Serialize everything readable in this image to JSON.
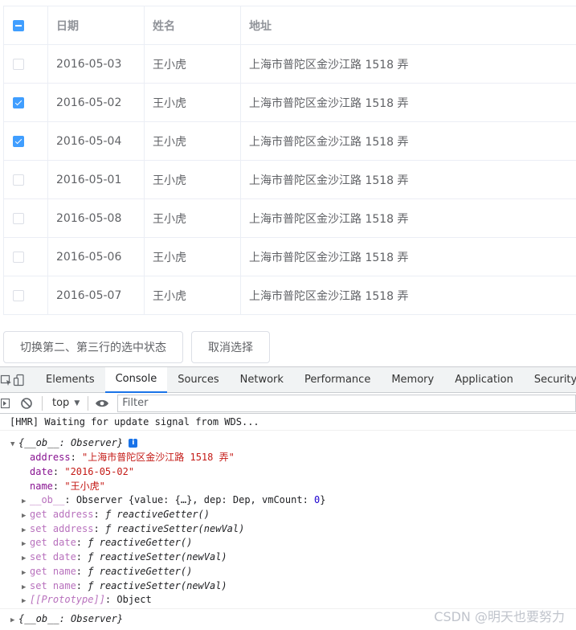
{
  "table": {
    "headers": {
      "date": "日期",
      "name": "姓名",
      "address": "地址"
    },
    "rows": [
      {
        "checked": false,
        "date": "2016-05-03",
        "name": "王小虎",
        "address": "上海市普陀区金沙江路 1518 弄"
      },
      {
        "checked": true,
        "date": "2016-05-02",
        "name": "王小虎",
        "address": "上海市普陀区金沙江路 1518 弄"
      },
      {
        "checked": true,
        "date": "2016-05-04",
        "name": "王小虎",
        "address": "上海市普陀区金沙江路 1518 弄"
      },
      {
        "checked": false,
        "date": "2016-05-01",
        "name": "王小虎",
        "address": "上海市普陀区金沙江路 1518 弄"
      },
      {
        "checked": false,
        "date": "2016-05-08",
        "name": "王小虎",
        "address": "上海市普陀区金沙江路 1518 弄"
      },
      {
        "checked": false,
        "date": "2016-05-06",
        "name": "王小虎",
        "address": "上海市普陀区金沙江路 1518 弄"
      },
      {
        "checked": false,
        "date": "2016-05-07",
        "name": "王小虎",
        "address": "上海市普陀区金沙江路 1518 弄"
      }
    ]
  },
  "buttons": {
    "toggle_label": "切换第二、第三行的选中状态",
    "clear_label": "取消选择"
  },
  "devtools": {
    "tabs": [
      "Elements",
      "Console",
      "Sources",
      "Network",
      "Performance",
      "Memory",
      "Application",
      "Security"
    ],
    "active_tab": "Console",
    "context": "top",
    "filter_placeholder": "Filter",
    "console": {
      "hmr": "[HMR] Waiting for update signal from WDS...",
      "obj_head_prefix": "{",
      "obj_head_key": "__ob__",
      "obj_head_sep": ": ",
      "obj_head_type": "Observer",
      "obj_head_suffix": "}",
      "info_badge": "i",
      "prop_address_key": "address",
      "prop_address_val": "\"上海市普陀区金沙江路 1518 弄\"",
      "prop_date_key": "date",
      "prop_date_val": "\"2016-05-02\"",
      "prop_name_key": "name",
      "prop_name_val": "\"王小虎\"",
      "ob_key": "__ob__",
      "ob_val_a": "Observer {value: {…}, dep: Dep, vmCount: ",
      "ob_val_num": "0",
      "ob_val_b": "}",
      "accessors": [
        {
          "key": "get address",
          "fn": "reactiveGetter()"
        },
        {
          "key": "set address",
          "fn": "reactiveSetter(newVal)"
        },
        {
          "key": "get date",
          "fn": "reactiveGetter()"
        },
        {
          "key": "set date",
          "fn": "reactiveSetter(newVal)"
        },
        {
          "key": "get name",
          "fn": "reactiveGetter()"
        },
        {
          "key": "set name",
          "fn": "reactiveSetter(newVal)"
        }
      ],
      "f_symbol": "ƒ",
      "proto_key": "[[Prototype]]",
      "proto_val": "Object",
      "obj2_prefix": "{",
      "obj2_key": "__ob__",
      "obj2_type": "Observer",
      "obj2_suffix": "}"
    }
  },
  "watermark": "CSDN @明天也要努力",
  "colors": {
    "checkbox_checked": "#409eff",
    "tab_active_underline": "#1a73e8"
  },
  "icons": [
    "inspect-icon",
    "device-toolbar-icon",
    "sidebar-toggle-icon",
    "clear-console-icon",
    "eye-icon",
    "dropdown-arrow-icon",
    "info-icon",
    "expand-triangle-icon"
  ]
}
